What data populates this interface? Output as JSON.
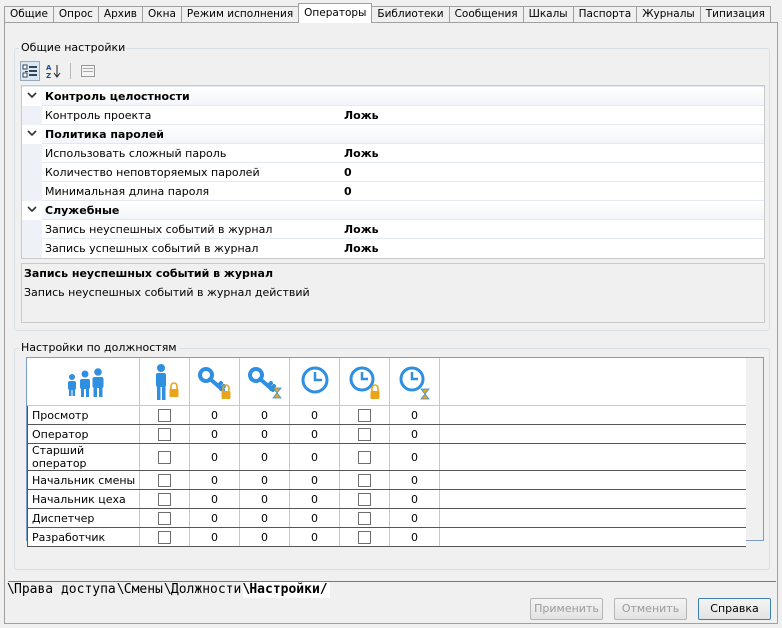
{
  "tabs": [
    "Общие",
    "Опрос",
    "Архив",
    "Окна",
    "Режим исполнения",
    "Операторы",
    "Библиотеки",
    "Сообщения",
    "Шкалы",
    "Паспорта",
    "Журналы",
    "Типизация"
  ],
  "general": {
    "title": "Общие настройки",
    "categories": [
      {
        "name": "Контроль целостности",
        "props": [
          {
            "name": "Контроль проекта",
            "value": "Ложь"
          }
        ]
      },
      {
        "name": "Политика паролей",
        "props": [
          {
            "name": "Использовать сложный пароль",
            "value": "Ложь"
          },
          {
            "name": "Количество неповторяемых паролей",
            "value": "0"
          },
          {
            "name": "Минимальная длина пароля",
            "value": "0"
          }
        ]
      },
      {
        "name": "Служебные",
        "props": [
          {
            "name": "Запись неуспешных событий в журнал",
            "value": "Ложь"
          },
          {
            "name": "Запись успешных событий в журнал",
            "value": "Ложь"
          }
        ]
      }
    ],
    "description": {
      "title": "Запись неуспешных событий в журнал",
      "text": "Запись неуспешных событий в журнал действий"
    }
  },
  "positions": {
    "title": "Настройки по должностям",
    "columns": [
      "group-icon",
      "person-lock-icon",
      "key-lock-icon",
      "key-hourglass-icon",
      "clock-icon",
      "clock-lock-icon",
      "clock-hourglass-icon"
    ],
    "rows": [
      {
        "name": "Просмотр",
        "c1": false,
        "c2": "0",
        "c3": "0",
        "c4": "0",
        "c5": false,
        "c6": "0"
      },
      {
        "name": "Оператор",
        "c1": false,
        "c2": "0",
        "c3": "0",
        "c4": "0",
        "c5": false,
        "c6": "0"
      },
      {
        "name": "Старший оператор",
        "c1": false,
        "c2": "0",
        "c3": "0",
        "c4": "0",
        "c5": false,
        "c6": "0"
      },
      {
        "name": "Начальник смены",
        "c1": false,
        "c2": "0",
        "c3": "0",
        "c4": "0",
        "c5": false,
        "c6": "0"
      },
      {
        "name": "Начальник цеха",
        "c1": false,
        "c2": "0",
        "c3": "0",
        "c4": "0",
        "c5": false,
        "c6": "0"
      },
      {
        "name": "Диспетчер",
        "c1": false,
        "c2": "0",
        "c3": "0",
        "c4": "0",
        "c5": false,
        "c6": "0"
      },
      {
        "name": "Разработчик",
        "c1": false,
        "c2": "0",
        "c3": "0",
        "c4": "0",
        "c5": false,
        "c6": "0"
      }
    ]
  },
  "bottom_tabs": [
    "Права доступа",
    "Смены",
    "Должности",
    "Настройки"
  ],
  "buttons": {
    "apply": "Применить",
    "cancel": "Отменить",
    "help": "Справка"
  },
  "colors": {
    "accent": "#2f8fe0",
    "lock": "#e8a51a"
  }
}
